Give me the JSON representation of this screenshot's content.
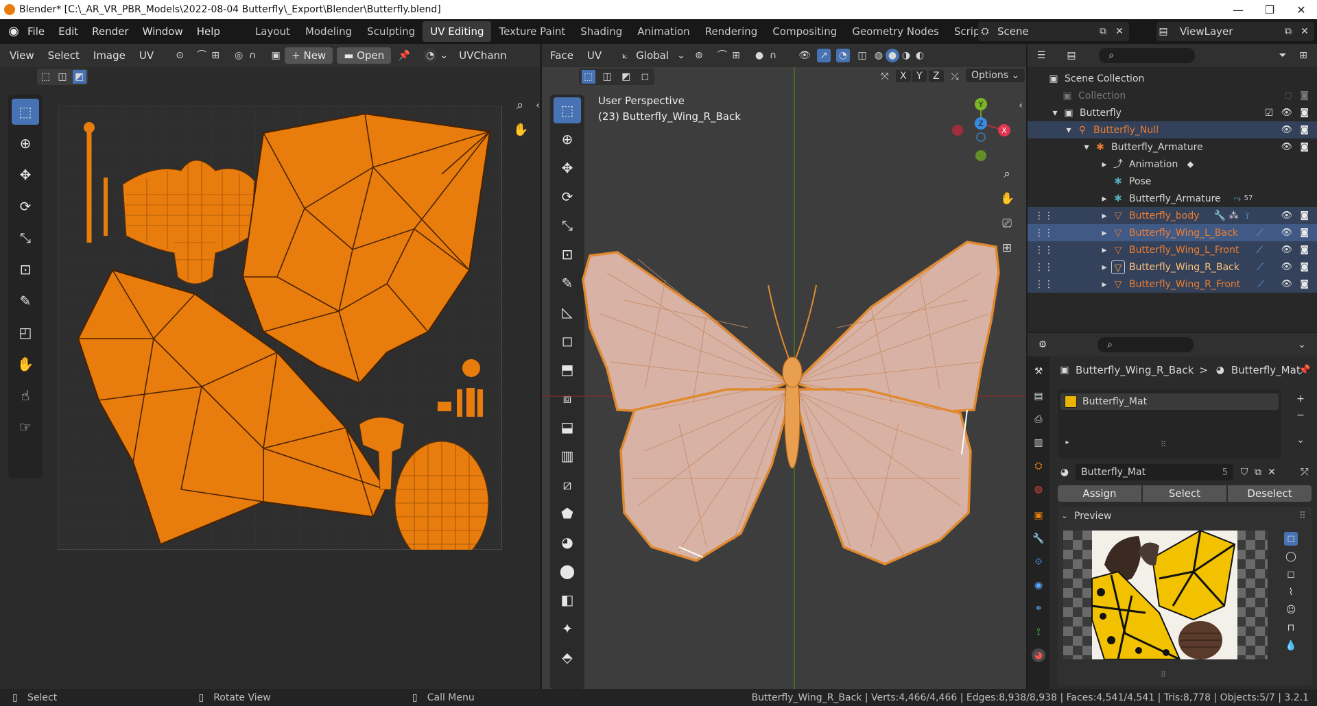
{
  "titlebar": {
    "title": "Blender* [C:\\_AR_VR_PBR_Models\\2022-08-04 Butterfly\\_Export\\Blender\\Butterfly.blend]",
    "minimize": "—",
    "maximize": "❐",
    "close": "✕"
  },
  "menu": {
    "items": [
      "File",
      "Edit",
      "Render",
      "Window",
      "Help"
    ]
  },
  "workspaces": [
    "Layout",
    "Modeling",
    "Sculpting",
    "UV Editing",
    "Texture Paint",
    "Shading",
    "Animation",
    "Rendering",
    "Compositing",
    "Geometry Nodes",
    "Scripting"
  ],
  "active_workspace": "UV Editing",
  "add_workspace": "+",
  "scene": {
    "label": "Scene",
    "viewlayer": "ViewLayer"
  },
  "uv_header": {
    "items": [
      "View",
      "Select",
      "Image",
      "UV"
    ],
    "new_label": "New",
    "open_label": "Open",
    "uv_channel": "UVChann"
  },
  "viewport_header": {
    "face": "Face",
    "uv": "UV",
    "orientation": "Global",
    "axes": [
      "X",
      "Y",
      "Z"
    ],
    "options": "Options"
  },
  "viewport": {
    "perspective": "User Perspective",
    "object_info": "(23) Butterfly_Wing_R_Back",
    "gizmo_y": "Y",
    "gizmo_z": "Z",
    "gizmo_x": "X"
  },
  "outliner": {
    "title": "Scene Collection",
    "rows": [
      {
        "label": "Collection"
      },
      {
        "label": "Butterfly"
      },
      {
        "label": "Butterfly_Null"
      },
      {
        "label": "Butterfly_Armature"
      },
      {
        "label": "Animation"
      },
      {
        "label": "Pose"
      },
      {
        "label": "Butterfly_Armature",
        "badge": "57"
      },
      {
        "label": "Butterfly_body"
      },
      {
        "label": "Butterfly_Wing_L_Back"
      },
      {
        "label": "Butterfly_Wing_L_Front"
      },
      {
        "label": "Butterfly_Wing_R_Back"
      },
      {
        "label": "Butterfly_Wing_R_Front"
      }
    ]
  },
  "properties": {
    "breadcrumb_object": "Butterfly_Wing_R_Back",
    "breadcrumb_sep": ">",
    "breadcrumb_material": "Butterfly_Mat",
    "slot_name": "Butterfly_Mat",
    "material_name": "Butterfly_Mat",
    "material_users": "5",
    "assign": "Assign",
    "select": "Select",
    "deselect": "Deselect",
    "preview_label": "Preview"
  },
  "status_bar": {
    "select": "Select",
    "rotate": "Rotate View",
    "menu": "Call Menu",
    "stats": "Butterfly_Wing_R_Back | Verts:4,466/4,466 | Edges:8,938/8,938 | Faces:4,541/4,541 | Tris:8,778 | Objects:5/7 | 3.2.1"
  },
  "colors": {
    "accent": "#4772b3",
    "uv_orange": "#e87d0d",
    "selected_object": "#ed7d31",
    "wing_fill": "#d8b2a4",
    "wing_tex_yellow": "#f2c200"
  }
}
